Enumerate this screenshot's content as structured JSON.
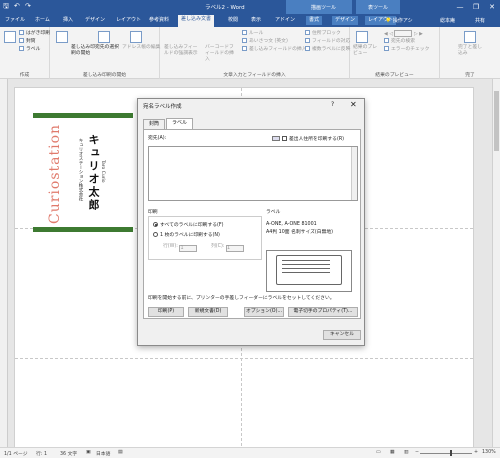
{
  "window": {
    "title": "ラベル2 - Word",
    "ctx_tool1": "描画ツール",
    "ctx_tool2": "表ツール",
    "qa_save": "🖫",
    "qa_undo": "↶",
    "qa_redo": "↷",
    "minimize": "—",
    "restore": "❐",
    "close": "✕"
  },
  "tabs": [
    "ファイル",
    "ホーム",
    "挿入",
    "デザイン",
    "レイアウト",
    "参考資料",
    "差し込み文書",
    "校閲",
    "表示",
    "アドイン",
    "書式",
    "デザイン",
    "レイアウト"
  ],
  "tell_me": "操作アシ",
  "user_name": "総本庵",
  "share": "共有",
  "ribbon": {
    "create": {
      "envelope": "はがき印刷",
      "sealing": "封筒",
      "label": "ラベル",
      "group": "作成"
    },
    "start": {
      "start_merge": "差し込み印刷の開始",
      "select_recipients": "宛先の選択",
      "edit_list": "アドレス帳の編集",
      "group": "差し込み印刷の開始"
    },
    "fields": {
      "highlight": "差し込みフィールドの強調表示",
      "address_block": "住所ブロック",
      "greeting": "あいさつ文 (英文)",
      "insert_field": "差し込みフィールドの挿入",
      "rules": "ルール",
      "match": "フィールドの対応",
      "update": "複数ラベルに反映",
      "block_field": "バーコードフィールドの挿入",
      "group": "文章入力とフィールドの挿入"
    },
    "preview": {
      "results": "結果のプレビュー",
      "find": "宛先の検索",
      "check": "エラーのチェック",
      "group": "結果のプレビュー"
    },
    "finish": {
      "finish_merge": "完了と差し込み",
      "group": "完了"
    }
  },
  "label_card": {
    "brand": "Curiostation",
    "company": "キュリオステーション株式会社",
    "person_name": "キュリオ太郎",
    "person_title": "Taro Curio"
  },
  "dialog": {
    "title": "宛名ラベル作成",
    "help": "?",
    "close": "✕",
    "tab_envelope": "封筒",
    "tab_label": "ラベル",
    "address_label": "宛先(A):",
    "use_return": "差出人住所を印刷する(R)",
    "print_group": "印刷",
    "print_all": "すべてのラベルに印刷する(F)",
    "print_one": "1 枚のラベルに印刷する(N)",
    "row_label": "行(W):",
    "row_value": "1",
    "col_label": "列(C):",
    "col_value": "1",
    "label_group": "ラベル",
    "label_vendor": "A-ONE, A-ONE 81001",
    "label_desc": "A4判 10面 名刺サイズ(白無地)",
    "hint": "印刷を開始する前に、プリンターの手差しフィーダーにラベルをセットしてください。",
    "btn_print": "印刷(P)",
    "btn_new": "新規文書(D)",
    "btn_options": "オプション(O)...",
    "btn_epostage": "電子切手のプロパティ(T)...",
    "btn_cancel": "キャンセル"
  },
  "statusbar": {
    "page": "1/1 ページ",
    "section": "行: 1",
    "words": "36 文字",
    "lang": "日本語",
    "zoom": "130%"
  }
}
